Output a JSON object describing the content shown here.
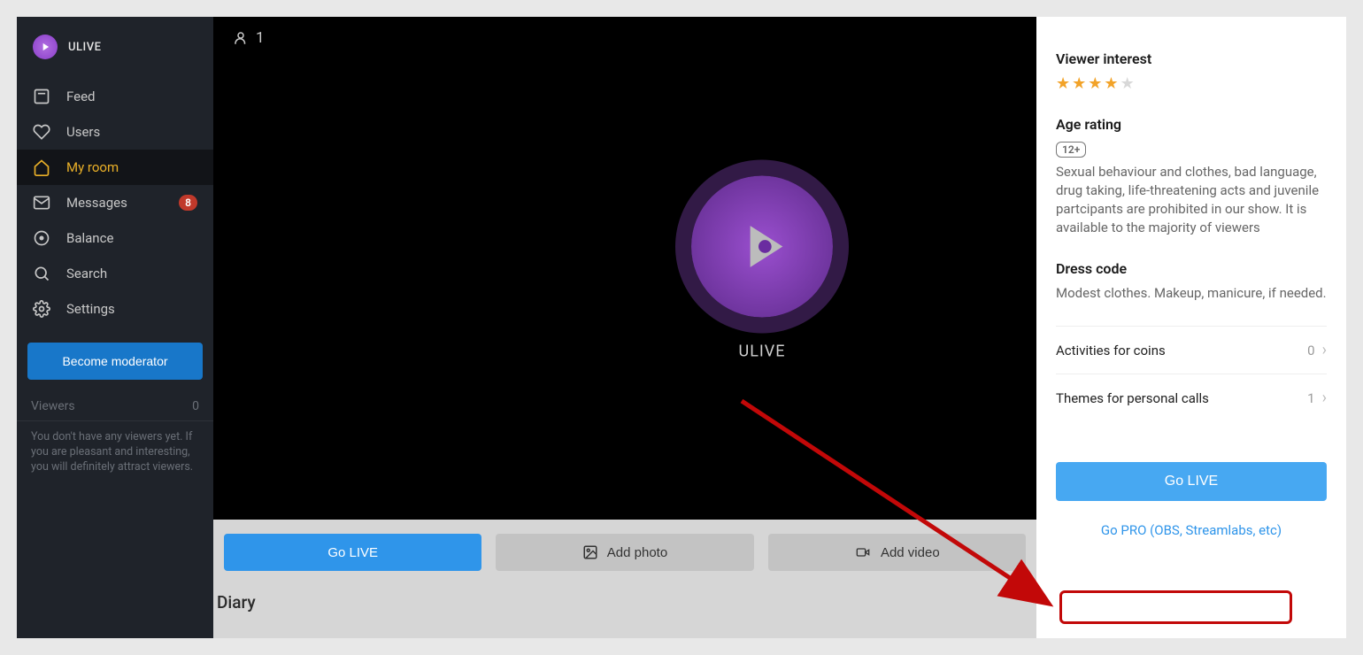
{
  "brand": {
    "name": "ULIVE"
  },
  "sidebar": {
    "items": [
      {
        "label": "Feed"
      },
      {
        "label": "Users"
      },
      {
        "label": "My room"
      },
      {
        "label": "Messages",
        "badge": "8"
      },
      {
        "label": "Balance"
      },
      {
        "label": "Search"
      },
      {
        "label": "Settings"
      }
    ],
    "moderator_btn": "Become moderator",
    "viewers_label": "Viewers",
    "viewers_count": "0",
    "viewers_desc": "You don't have any viewers yet. If you are pleasant and interesting, you will definitely attract viewers."
  },
  "video": {
    "viewer_count": "1",
    "placeholder": "ULIVE"
  },
  "actions": {
    "go_live": "Go LIVE",
    "add_photo": "Add photo",
    "add_video": "Add video"
  },
  "diary_title": "Diary",
  "right": {
    "viewer_interest_title": "Viewer interest",
    "rating_stars": 4,
    "age_title": "Age rating",
    "age_badge": "12+",
    "age_text": "Sexual behaviour and clothes, bad language, drug taking, life-threatening acts and juvenile partcipants are prohibited in our show. It is available to the majority of viewers",
    "dress_title": "Dress code",
    "dress_text": "Modest clothes. Makeup, manicure, if needed.",
    "rows": [
      {
        "label": "Activities for coins",
        "value": "0"
      },
      {
        "label": "Themes for personal calls",
        "value": "1"
      }
    ],
    "go_live": "Go LIVE",
    "go_pro": "Go PRO (OBS, Streamlabs, etc)"
  }
}
